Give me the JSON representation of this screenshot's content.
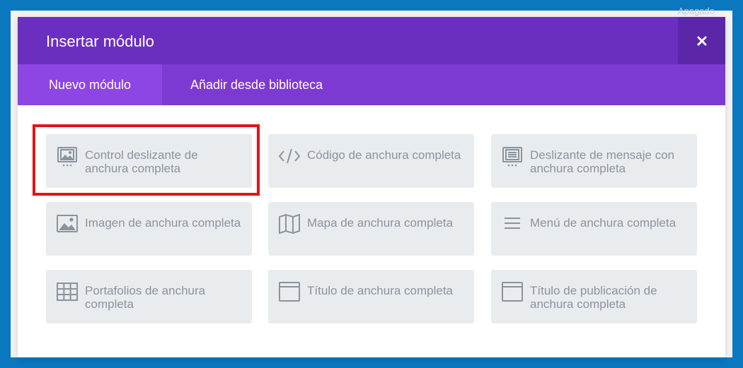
{
  "background": {
    "faded_text": "Apagado"
  },
  "modal": {
    "title": "Insertar módulo",
    "close_glyph": "×",
    "tabs": [
      {
        "label": "Nuevo módulo",
        "active": true
      },
      {
        "label": "Añadir desde biblioteca",
        "active": false
      }
    ],
    "modules": [
      {
        "label": "Control deslizante de anchura completa",
        "icon": "slider-icon",
        "highlighted": true
      },
      {
        "label": "Código de anchura completa",
        "icon": "code-icon",
        "highlighted": false
      },
      {
        "label": "Deslizante de mensaje con anchura completa",
        "icon": "post-slider-icon",
        "highlighted": false
      },
      {
        "label": "Imagen de anchura completa",
        "icon": "image-icon",
        "highlighted": false
      },
      {
        "label": "Mapa de anchura completa",
        "icon": "map-icon",
        "highlighted": false
      },
      {
        "label": "Menú de anchura completa",
        "icon": "menu-icon",
        "highlighted": false
      },
      {
        "label": "Portafolios de anchura completa",
        "icon": "grid-icon",
        "highlighted": false
      },
      {
        "label": "Título de anchura completa",
        "icon": "header-icon",
        "highlighted": false
      },
      {
        "label": "Título de publicación de anchura completa",
        "icon": "post-title-icon",
        "highlighted": false
      }
    ]
  },
  "colors": {
    "header": "#6b2fc0",
    "tabs_bar": "#7d3ad3",
    "tab_active": "#8d45e3",
    "card_bg": "#e9ecef",
    "card_text": "#8a939c",
    "highlight": "#e3131a",
    "page_border": "#0a77bf"
  }
}
